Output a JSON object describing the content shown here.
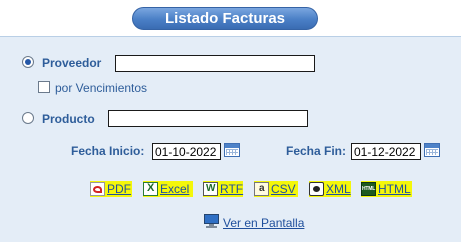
{
  "header": {
    "title": "Listado Facturas"
  },
  "form": {
    "proveedor": {
      "label": "Proveedor",
      "value": "",
      "selected": true
    },
    "vencimientos": {
      "label": "por Vencimientos",
      "checked": false
    },
    "producto": {
      "label": "Producto",
      "value": "",
      "selected": false
    },
    "fecha_inicio": {
      "label": "Fecha Inicio:",
      "value": "01-10-2022"
    },
    "fecha_fin": {
      "label": "Fecha Fin:",
      "value": "01-12-2022"
    }
  },
  "exports": {
    "pdf": {
      "label": "PDF",
      "icon": "pdf-icon"
    },
    "excel": {
      "label": "Excel",
      "icon": "excel-icon"
    },
    "rtf": {
      "label": "RTF",
      "icon": "word-icon"
    },
    "csv": {
      "label": "CSV",
      "icon": "csv-icon"
    },
    "xml": {
      "label": "XML",
      "icon": "xml-icon"
    },
    "html": {
      "label": "HTML",
      "icon": "html-icon"
    }
  },
  "screen_link": {
    "label": "Ver en Pantalla",
    "icon": "monitor-icon"
  },
  "colors": {
    "accent": "#2e5d9a",
    "panel": "#e4edf7",
    "highlight": "#f4f70a"
  }
}
